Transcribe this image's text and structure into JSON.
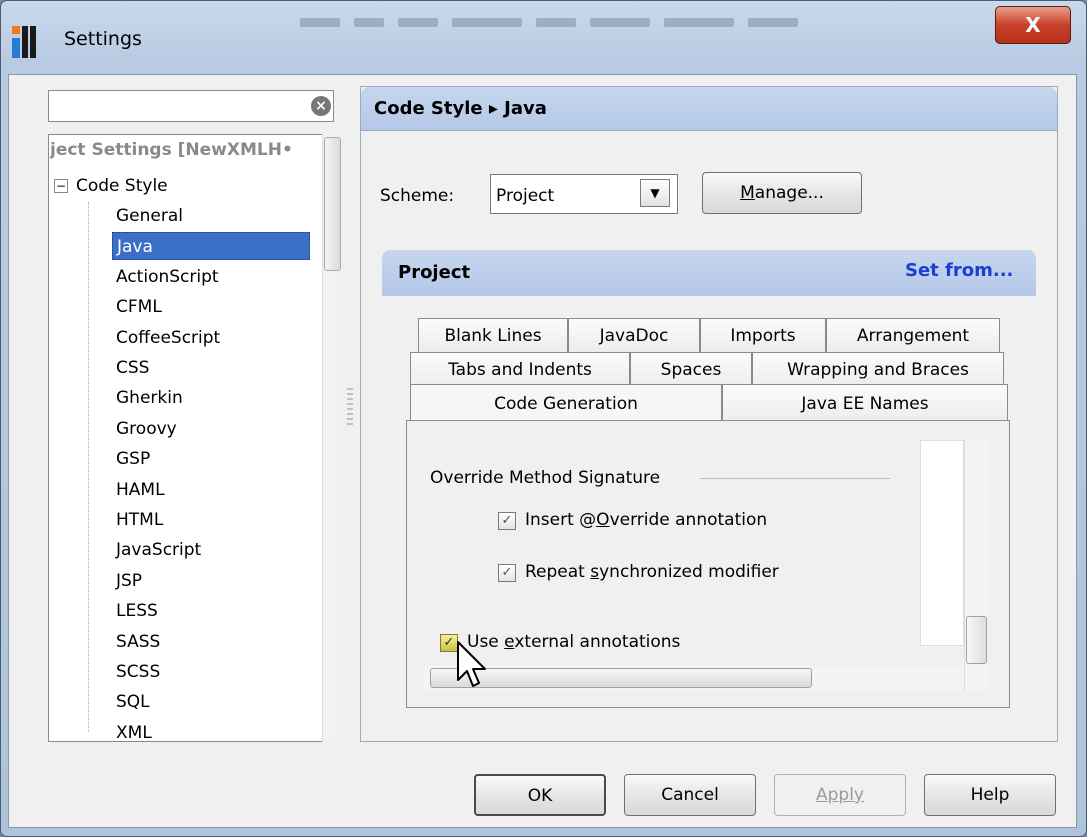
{
  "window": {
    "title": "Settings",
    "close_label": "X"
  },
  "search": {
    "value": "",
    "placeholder": ""
  },
  "tree": {
    "header": "ject Settings [NewXMLH•",
    "expander": "−",
    "codestyle_label": "Code Style",
    "items": [
      "General",
      "Java",
      "ActionScript",
      "CFML",
      "CoffeeScript",
      "CSS",
      "Gherkin",
      "Groovy",
      "GSP",
      "HAML",
      "HTML",
      "JavaScript",
      "JSP",
      "LESS",
      "SASS",
      "SCSS",
      "SQL",
      "XML"
    ],
    "selected_index": 1
  },
  "breadcrumb": "Code Style ▸ Java",
  "scheme": {
    "label": "Scheme:",
    "value": "Project",
    "manage_label": "Manage..."
  },
  "project": {
    "title": "Project",
    "set_from": "Set from..."
  },
  "tabs": {
    "row1": [
      "Blank Lines",
      "JavaDoc",
      "Imports",
      "Arrangement"
    ],
    "row2": [
      "Tabs and Indents",
      "Spaces",
      "Wrapping and Braces"
    ],
    "row3": [
      "Code Generation",
      "Java EE Names"
    ],
    "active": "Code Generation"
  },
  "override": {
    "group_label": "Override Method Signature",
    "insert_override": {
      "label": "Insert @Override annotation",
      "checked": true
    },
    "repeat_synchronized": {
      "label": "Repeat synchronized modifier",
      "checked": true
    }
  },
  "external_annotations": {
    "label": "Use external annotations",
    "checked": true
  },
  "buttons": {
    "ok": "OK",
    "cancel": "Cancel",
    "apply": "Apply",
    "help": "Help"
  },
  "icons": {
    "app": "intellij-icon",
    "check": "✓",
    "clear": "×",
    "dropdown": "▼"
  }
}
